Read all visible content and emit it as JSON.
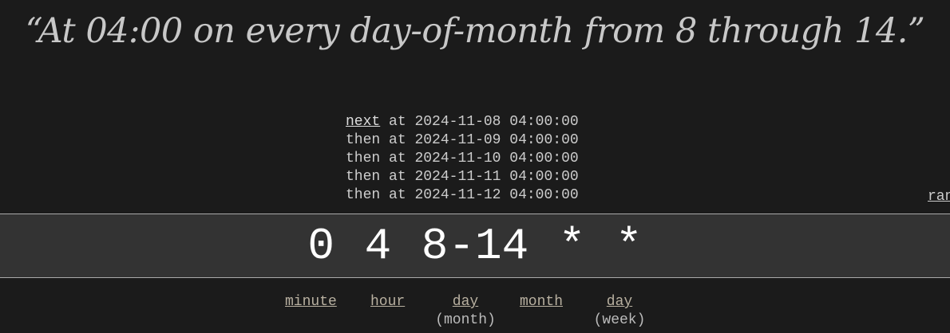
{
  "description": "“At 04:00 on every day-of-month from 8 through 14.”",
  "next_link": "next",
  "schedule": [
    {
      "prefix": "next",
      "at": "at",
      "time": "2024-11-08 04:00:00"
    },
    {
      "prefix": "then",
      "at": "at",
      "time": "2024-11-09 04:00:00"
    },
    {
      "prefix": "then",
      "at": "at",
      "time": "2024-11-10 04:00:00"
    },
    {
      "prefix": "then",
      "at": "at",
      "time": "2024-11-11 04:00:00"
    },
    {
      "prefix": "then",
      "at": "at",
      "time": "2024-11-12 04:00:00"
    }
  ],
  "random_link": "random",
  "expression": "0 4 8-14 * *",
  "fields": [
    {
      "label": "minute",
      "sub": ""
    },
    {
      "label": "hour",
      "sub": ""
    },
    {
      "label": "day",
      "sub": "(month)"
    },
    {
      "label": "month",
      "sub": ""
    },
    {
      "label": "day",
      "sub": "(week)"
    }
  ]
}
